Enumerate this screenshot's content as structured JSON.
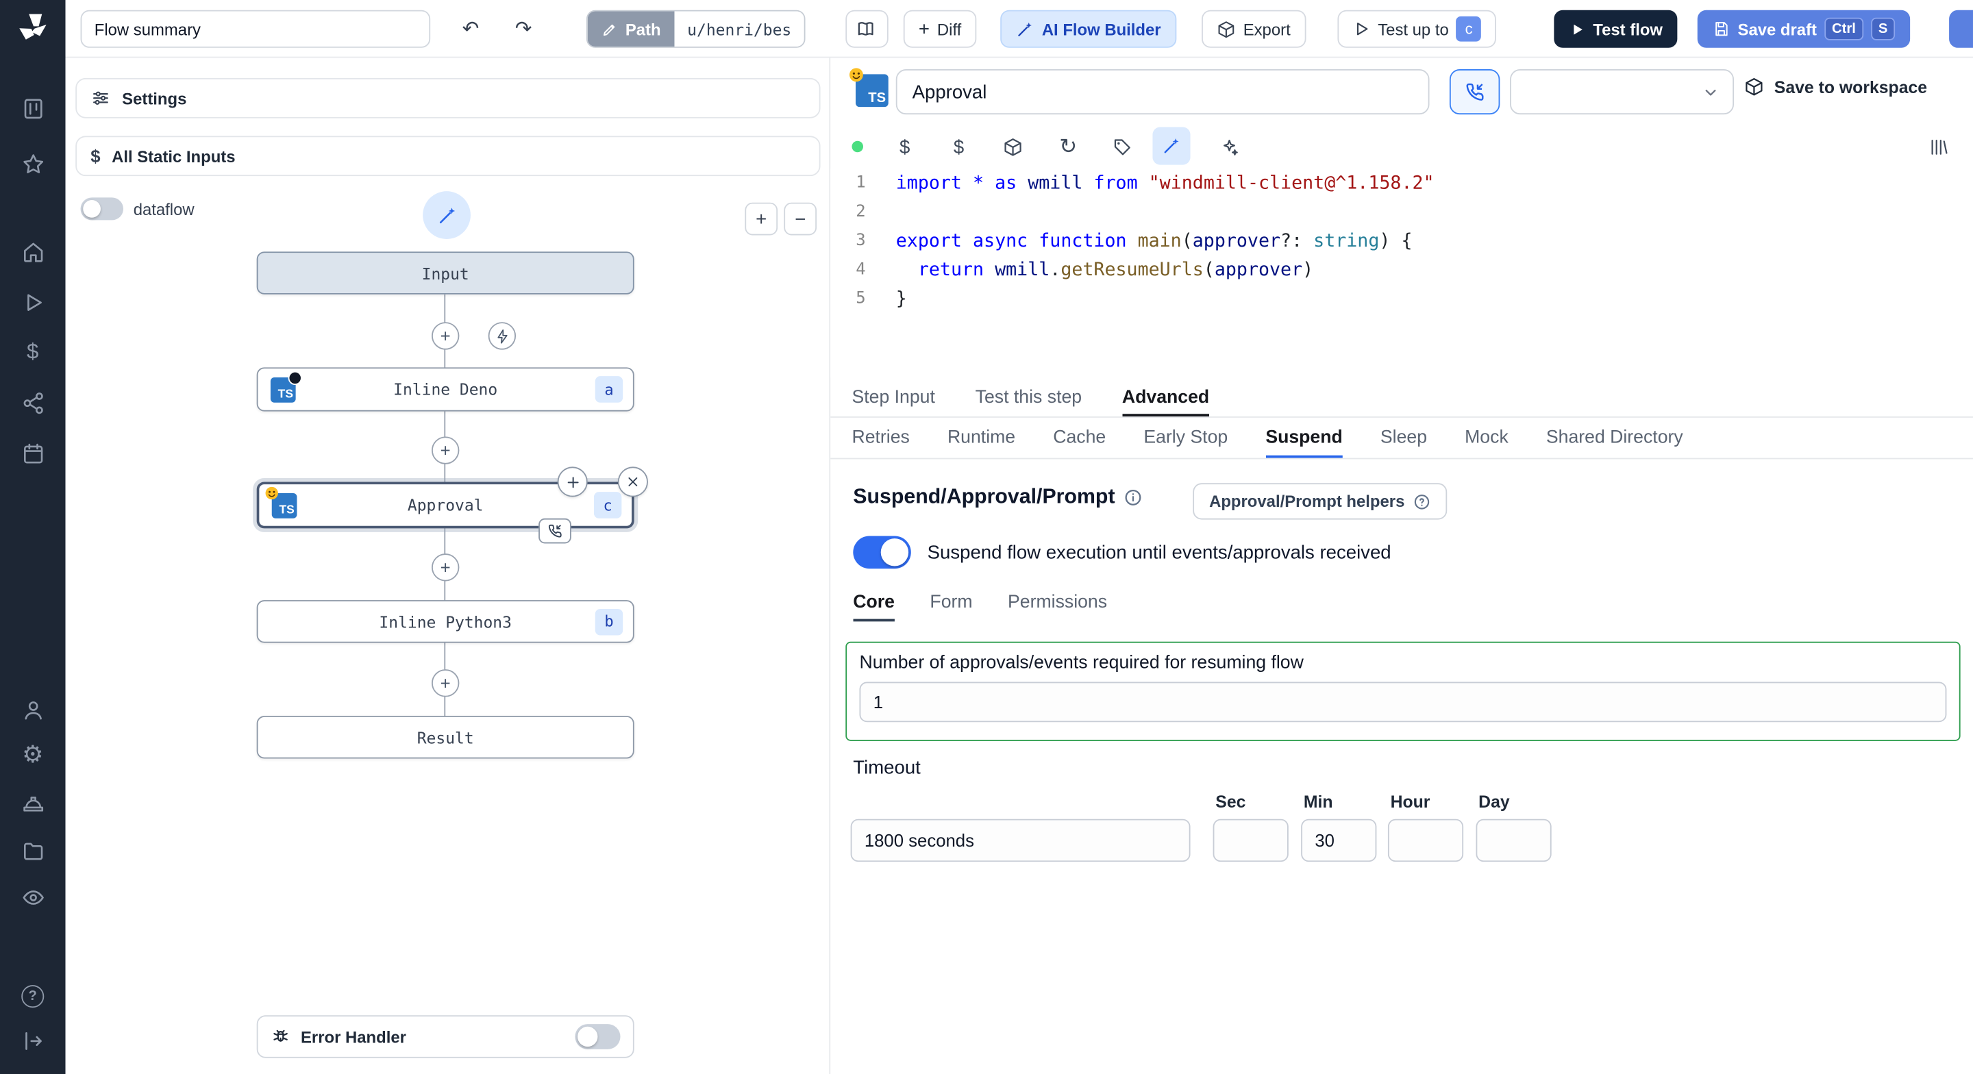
{
  "topbar": {
    "flow_summary_value": "Flow summary",
    "path_label": "Path",
    "path_value": "u/henri/bes",
    "diff_label": "Diff",
    "ai_builder_label": "AI Flow Builder",
    "export_label": "Export",
    "test_up_to_label": "Test up to",
    "test_up_to_badge": "c",
    "test_flow_label": "Test flow",
    "save_draft_label": "Save draft",
    "save_draft_keys": [
      "Ctrl",
      "S"
    ]
  },
  "sidebar": {
    "icons": [
      "windmill-logo",
      "kanban",
      "star",
      "home",
      "runs",
      "variables",
      "flows",
      "schedules",
      "user",
      "settings",
      "workers",
      "folders",
      "audit-logs",
      "help",
      "collapse"
    ]
  },
  "flow_panel": {
    "settings_label": "Settings",
    "static_inputs_label": "All Static Inputs",
    "dataflow_label": "dataflow",
    "nodes": {
      "input_label": "Input",
      "deno_label": "Inline Deno",
      "deno_badge": "a",
      "approval_label": "Approval",
      "approval_badge": "c",
      "python_label": "Inline Python3",
      "python_badge": "b",
      "result_label": "Result"
    },
    "error_handler_label": "Error Handler"
  },
  "step_editor": {
    "language_badge": "TS",
    "name_value": "Approval",
    "save_to_workspace_label": "Save to workspace"
  },
  "code": {
    "lines": [
      [
        {
          "t": "import",
          "c": "kw"
        },
        {
          "t": " ",
          "c": "pl"
        },
        {
          "t": "*",
          "c": "kw"
        },
        {
          "t": " ",
          "c": "pl"
        },
        {
          "t": "as",
          "c": "kw"
        },
        {
          "t": " ",
          "c": "pl"
        },
        {
          "t": "wmill",
          "c": "id"
        },
        {
          "t": " ",
          "c": "pl"
        },
        {
          "t": "from",
          "c": "kw"
        },
        {
          "t": " ",
          "c": "pl"
        },
        {
          "t": "\"windmill-client@^1.158.2\"",
          "c": "str"
        }
      ],
      [],
      [
        {
          "t": "export",
          "c": "kw"
        },
        {
          "t": " ",
          "c": "pl"
        },
        {
          "t": "async",
          "c": "kw"
        },
        {
          "t": " ",
          "c": "pl"
        },
        {
          "t": "function",
          "c": "kw"
        },
        {
          "t": " ",
          "c": "pl"
        },
        {
          "t": "main",
          "c": "fn"
        },
        {
          "t": "(",
          "c": "pl"
        },
        {
          "t": "approver",
          "c": "id"
        },
        {
          "t": "?: ",
          "c": "pl"
        },
        {
          "t": "string",
          "c": "ty"
        },
        {
          "t": ") {",
          "c": "pl"
        }
      ],
      [
        {
          "t": "  ",
          "c": "pl"
        },
        {
          "t": "return",
          "c": "kw"
        },
        {
          "t": " ",
          "c": "pl"
        },
        {
          "t": "wmill",
          "c": "id"
        },
        {
          "t": ".",
          "c": "pl"
        },
        {
          "t": "getResumeUrls",
          "c": "fn"
        },
        {
          "t": "(",
          "c": "pl"
        },
        {
          "t": "approver",
          "c": "id"
        },
        {
          "t": ")",
          "c": "pl"
        }
      ],
      [
        {
          "t": "}",
          "c": "pl"
        }
      ]
    ]
  },
  "tabs": {
    "primary": {
      "items": [
        "Step Input",
        "Test this step",
        "Advanced"
      ],
      "selected": "Advanced"
    },
    "advanced": {
      "items": [
        "Retries",
        "Runtime",
        "Cache",
        "Early Stop",
        "Suspend",
        "Sleep",
        "Mock",
        "Shared Directory"
      ],
      "selected": "Suspend"
    }
  },
  "suspend": {
    "title": "Suspend/Approval/Prompt",
    "helpers_button_label": "Approval/Prompt helpers",
    "toggle_label": "Suspend flow execution until events/approvals received",
    "toggle_on": true,
    "sub_tabs": {
      "items": [
        "Core",
        "Form",
        "Permissions"
      ],
      "selected": "Core"
    },
    "approvals_label": "Number of approvals/events required for resuming flow",
    "approvals_value": "1",
    "timeout_label": "Timeout",
    "timeout_value": "1800 seconds",
    "time_units": [
      {
        "label": "Sec",
        "value": ""
      },
      {
        "label": "Min",
        "value": "30"
      },
      {
        "label": "Hour",
        "value": ""
      },
      {
        "label": "Day",
        "value": ""
      }
    ]
  },
  "colors": {
    "accent_blue": "#2f6bf0",
    "save_draft_blue": "#5a80e0",
    "dark_navy": "#14243a",
    "suspend_box_green": "#2f9e4f",
    "badge_bg": "#dbeafe",
    "badge_text": "#1e40af"
  }
}
